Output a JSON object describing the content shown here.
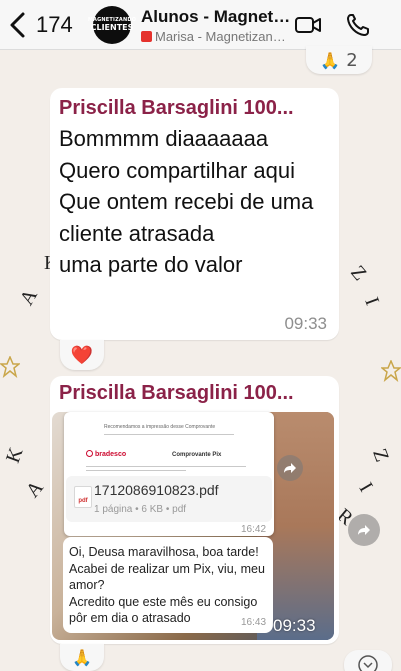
{
  "header": {
    "back_count": "174",
    "avatar_line1": "MAGNETIZANDO",
    "avatar_line2": "CLIENTES",
    "title": "Alunos - Magnetizando Clientes",
    "subtitle": "Marisa - Magnetizando Clientes"
  },
  "top_reaction": {
    "emoji": "🙏",
    "count": "2"
  },
  "message1": {
    "sender": "Priscilla Barsaglini 100...",
    "text": "Bommmm diaaaaaaa\nQuero compartilhar aqui\nQue ontem recebi de uma cliente atrasada\numa parte do valor",
    "time": "09:33",
    "reaction": "❤️"
  },
  "message2": {
    "sender": "Priscilla Barsaglini 100...",
    "receipt": {
      "header_text": "Recomendamos a impressão desse Comprovante",
      "bank": "bradesco",
      "label": "Comprovante Pix"
    },
    "file": {
      "name": "1712086910823.pdf",
      "meta": "1 página • 6 KB • pdf",
      "icon_label": "pdf",
      "time": "16:42"
    },
    "quoted_text": "Oi, Deusa maravilhosa, boa tarde!\nAcabei de realizar um Pix, viu, meu amor?\nAcredito que este mês eu consigo pôr em dia o atrasado",
    "quoted_time": "16:43",
    "time": "09:33",
    "reaction": "🙏"
  },
  "decorations": {
    "letters_left_top": "K",
    "letters_left_top2": "A",
    "letters_right_top": "Z",
    "letters_right_top2": "I",
    "letters_left_bottom": "K",
    "letters_left_bottom2": "A",
    "letters_right_bottom": "Z",
    "letters_right_bottom2": "I",
    "letters_right_bottom3": "R"
  },
  "colors": {
    "sender": "#8b2248",
    "header_bg": "#f7f7f7",
    "chat_bg": "#f3eee9",
    "bubble": "#ffffff"
  }
}
